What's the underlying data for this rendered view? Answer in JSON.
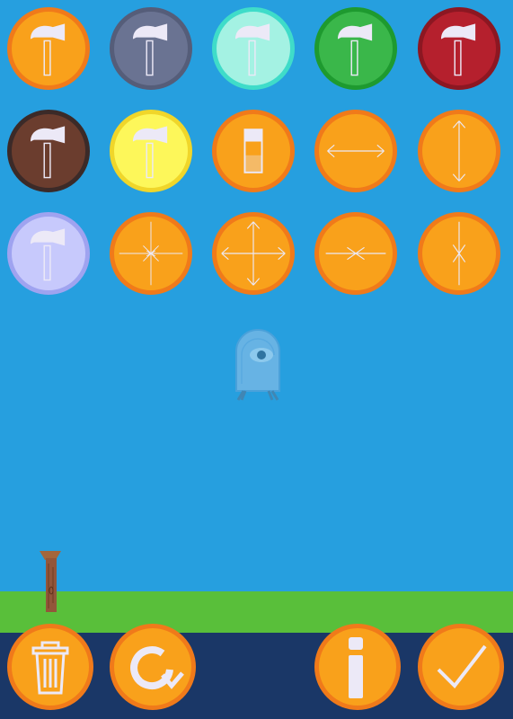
{
  "colors": {
    "sky": "#269fdf",
    "ground": "#59bf3a",
    "bottom_bar": "#1a3767",
    "button_fill": "#f9a11b",
    "button_border": "#f07a1a",
    "icon_stroke": "#ece9f7"
  },
  "tools": [
    {
      "icon": "hammer-icon",
      "fill": "#f9a11b",
      "border": "#f07a1a"
    },
    {
      "icon": "hammer-icon",
      "fill": "#6a7392",
      "border": "#555d79"
    },
    {
      "icon": "hammer-icon",
      "fill": "#a4f2e3",
      "border": "#3fdcc9"
    },
    {
      "icon": "hammer-icon",
      "fill": "#3ab74a",
      "border": "#1e9a2f"
    },
    {
      "icon": "hammer-icon",
      "fill": "#b5202d",
      "border": "#8c1722"
    },
    {
      "icon": "hammer-icon",
      "fill": "#6b3d2e",
      "border": "#3b2a28"
    },
    {
      "icon": "hammer-icon",
      "fill": "#fdf75a",
      "border": "#f0d62a"
    },
    {
      "icon": "eraser-icon",
      "fill": "#f9a11b",
      "border": "#f07a1a"
    },
    {
      "icon": "horizontal-arrows-icon",
      "fill": "#f9a11b",
      "border": "#f07a1a"
    },
    {
      "icon": "vertical-arrows-icon",
      "fill": "#f9a11b",
      "border": "#f07a1a"
    },
    {
      "icon": "hammer-icon",
      "fill": "#c7c9fc",
      "border": "#9fa3f0"
    },
    {
      "icon": "starburst-icon",
      "fill": "#f9a11b",
      "border": "#f07a1a"
    },
    {
      "icon": "four-way-arrows-icon",
      "fill": "#f9a11b",
      "border": "#f07a1a"
    },
    {
      "icon": "horizontal-compress-icon",
      "fill": "#f9a11b",
      "border": "#f07a1a"
    },
    {
      "icon": "vertical-compress-icon",
      "fill": "#f9a11b",
      "border": "#f07a1a"
    }
  ],
  "bottom_buttons": [
    {
      "icon": "trash-icon"
    },
    {
      "icon": "reset-icon"
    },
    {
      "icon": "info-icon"
    },
    {
      "icon": "checkmark-icon"
    }
  ],
  "scene": {
    "character_icon": "cyclops-ghost-icon",
    "stake_icon": "wooden-stake-icon"
  }
}
